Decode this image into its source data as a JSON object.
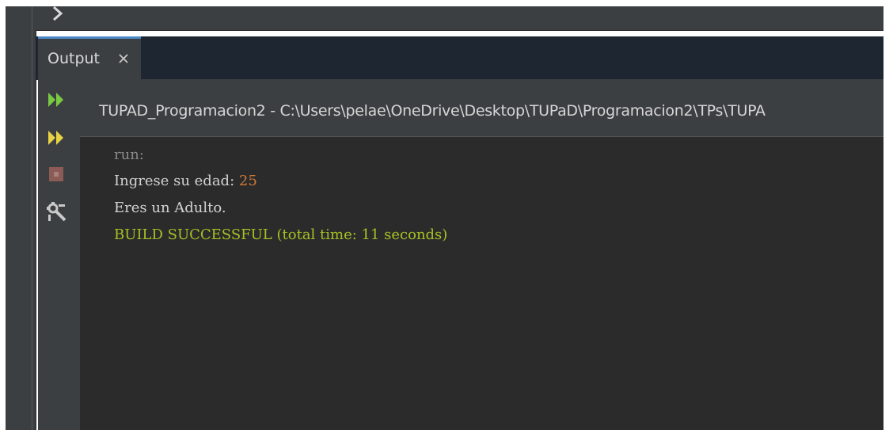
{
  "output_panel": {
    "tab_label": "Output",
    "header_path": "TUPAD_Programacion2 - C:\\Users\\pelae\\OneDrive\\Desktop\\TUPaD\\Programacion2\\TPs\\TUPA"
  },
  "toolbar": {
    "icons": [
      "rerun-icon",
      "rerun-with-params-icon",
      "stop-icon",
      "settings-icon"
    ]
  },
  "console": {
    "line_run": "run:",
    "line_prompt": "Ingrese su edad: ",
    "line_input": "25",
    "line_result": "Eres un Adulto.",
    "line_build": "BUILD SUCCESSFUL (total time: 11 seconds)"
  },
  "colors": {
    "console_bg": "#2b2b2b",
    "run_text": "#8a8a8a",
    "normal_text": "#d2d2d2",
    "input_text": "#d07a3a",
    "success_text": "#a8c023",
    "tab_accent": "#4a88c7"
  }
}
